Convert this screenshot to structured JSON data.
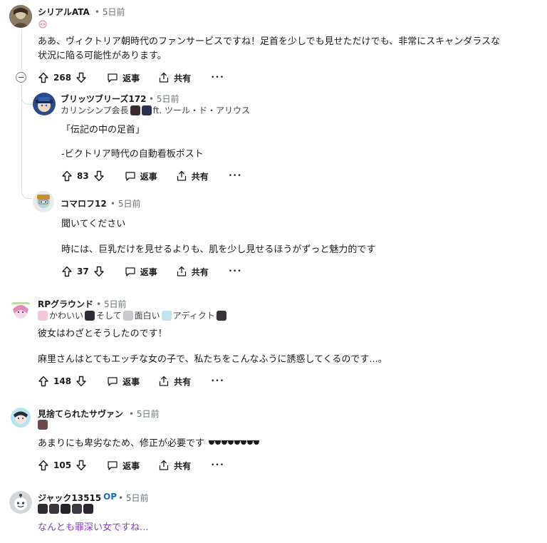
{
  "comments": [
    {
      "username": "シリアルATA",
      "time": "• 5日前",
      "lines": [
        "ああ、ヴィクトリア朝時代のファンサービスですね！足首を少しでも見せただけでも、非常にスキャンダラスな",
        "状況に陥る可能性があります。"
      ],
      "votes": "268",
      "reply": "返事",
      "share": "共有",
      "more": "•••"
    },
    {
      "username": "ブリッツブリーズ172",
      "time": "• 5日前",
      "flair": "カリンシンプ会長",
      "flair2": "ft. ツール・ド・アリウス",
      "lines": [
        "「伝記の中の足首」",
        "-ビクトリア時代の自動看板ポスト"
      ],
      "votes": "83",
      "reply": "返事",
      "share": "共有",
      "more": "•••"
    },
    {
      "username": "コマロフ12",
      "time": "• 5日前",
      "lines": [
        "聞いてください",
        "時には、巨乳だけを見せるよりも、肌を少し見せるほうがずっと魅力的です"
      ],
      "votes": "37",
      "reply": "返事",
      "share": "共有",
      "more": "•••"
    },
    {
      "username": "RPグラウンド",
      "time": "• 5日前",
      "flair": [
        "かわいい",
        "そして",
        "面白い",
        "アディクト"
      ],
      "lines": [
        "彼女はわざとそうしたのです！",
        "麻里さんはとてもエッチな女の子で、私たちをこんなふうに誘惑してくるのです...。"
      ],
      "votes": "148",
      "reply": "返事",
      "share": "共有",
      "more": "•••"
    },
    {
      "username": "見捨てられたサヴァン",
      "time": "• 5日前",
      "lines": [
        "あまりにも卑劣なため、修正が必要です"
      ],
      "votes": "105",
      "reply": "返事",
      "share": "共有",
      "more": "•••"
    },
    {
      "username": "ジャック13515",
      "op": "OP",
      "time": "• 5日前",
      "lines": [
        "なんとも罪深い女ですね..."
      ]
    }
  ],
  "colors": {
    "text": "#1c1c1c",
    "meta": "#6a7479",
    "op_blue": "#1d6ac5",
    "purple_text": "#8b3ec9",
    "thread_line": "#d9dde0"
  },
  "icons": [
    "upvote-icon",
    "downvote-icon",
    "comment-icon",
    "share-icon",
    "more-icon",
    "collapse-icon",
    "sunglasses-emoji"
  ]
}
